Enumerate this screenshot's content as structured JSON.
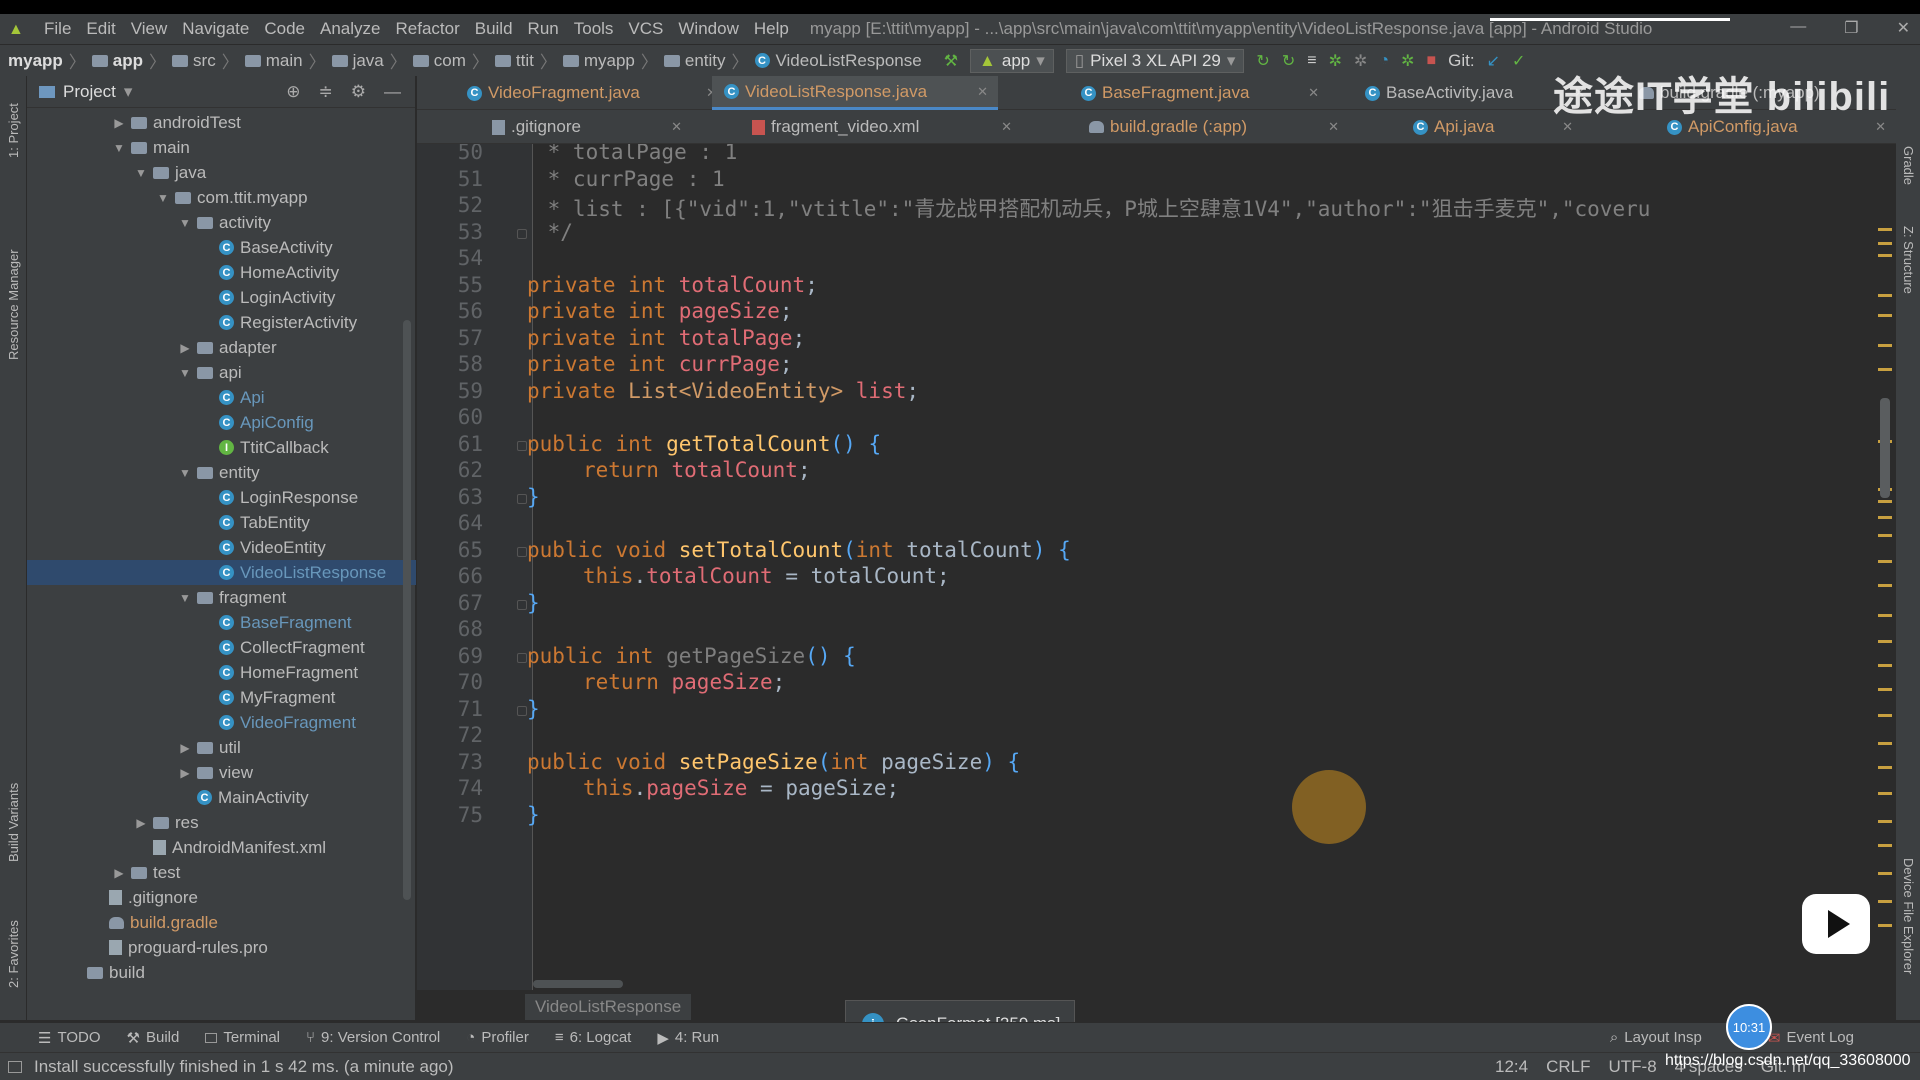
{
  "menu": {
    "items": [
      "File",
      "Edit",
      "View",
      "Navigate",
      "Code",
      "Analyze",
      "Refactor",
      "Build",
      "Run",
      "Tools",
      "VCS",
      "Window",
      "Help"
    ],
    "window_title": "myapp [E:\\ttit\\myapp] - ...\\app\\src\\main\\java\\com\\ttit\\myapp\\entity\\VideoListResponse.java [app] - Android Studio"
  },
  "nav": {
    "crumbs": [
      "myapp",
      "app",
      "src",
      "main",
      "java",
      "com",
      "ttit",
      "myapp",
      "entity",
      "VideoListResponse"
    ],
    "run_config": "app",
    "device": "Pixel 3 XL API 29",
    "git_label": "Git:"
  },
  "project_panel": {
    "title": "Project",
    "tree": [
      {
        "label": "androidTest",
        "depth": 1,
        "type": "folder",
        "arrow": "right"
      },
      {
        "label": "main",
        "depth": 1,
        "type": "folder",
        "arrow": "down"
      },
      {
        "label": "java",
        "depth": 2,
        "type": "folder",
        "arrow": "down"
      },
      {
        "label": "com.ttit.myapp",
        "depth": 3,
        "type": "package",
        "arrow": "down"
      },
      {
        "label": "activity",
        "depth": 4,
        "type": "package",
        "arrow": "down"
      },
      {
        "label": "BaseActivity",
        "depth": 5,
        "type": "class"
      },
      {
        "label": "HomeActivity",
        "depth": 5,
        "type": "class"
      },
      {
        "label": "LoginActivity",
        "depth": 5,
        "type": "class"
      },
      {
        "label": "RegisterActivity",
        "depth": 5,
        "type": "class"
      },
      {
        "label": "adapter",
        "depth": 4,
        "type": "package",
        "arrow": "right"
      },
      {
        "label": "api",
        "depth": 4,
        "type": "package",
        "arrow": "down"
      },
      {
        "label": "Api",
        "depth": 5,
        "type": "class",
        "highlight": true
      },
      {
        "label": "ApiConfig",
        "depth": 5,
        "type": "class",
        "highlight": true
      },
      {
        "label": "TtitCallback",
        "depth": 5,
        "type": "interface"
      },
      {
        "label": "entity",
        "depth": 4,
        "type": "package",
        "arrow": "down"
      },
      {
        "label": "LoginResponse",
        "depth": 5,
        "type": "class"
      },
      {
        "label": "TabEntity",
        "depth": 5,
        "type": "class"
      },
      {
        "label": "VideoEntity",
        "depth": 5,
        "type": "class"
      },
      {
        "label": "VideoListResponse",
        "depth": 5,
        "type": "class",
        "highlight": true,
        "selected": true
      },
      {
        "label": "fragment",
        "depth": 4,
        "type": "package",
        "arrow": "down"
      },
      {
        "label": "BaseFragment",
        "depth": 5,
        "type": "class",
        "highlight": true
      },
      {
        "label": "CollectFragment",
        "depth": 5,
        "type": "class"
      },
      {
        "label": "HomeFragment",
        "depth": 5,
        "type": "class"
      },
      {
        "label": "MyFragment",
        "depth": 5,
        "type": "class"
      },
      {
        "label": "VideoFragment",
        "depth": 5,
        "type": "class",
        "highlight": true
      },
      {
        "label": "util",
        "depth": 4,
        "type": "package",
        "arrow": "right"
      },
      {
        "label": "view",
        "depth": 4,
        "type": "package",
        "arrow": "right"
      },
      {
        "label": "MainActivity",
        "depth": 4,
        "type": "class"
      },
      {
        "label": "res",
        "depth": 2,
        "type": "folder",
        "arrow": "right"
      },
      {
        "label": "AndroidManifest.xml",
        "depth": 2,
        "type": "file"
      },
      {
        "label": "test",
        "depth": 1,
        "type": "folder",
        "arrow": "right"
      },
      {
        "label": ".gitignore",
        "depth": 0,
        "type": "file"
      },
      {
        "label": "build.gradle",
        "depth": 0,
        "type": "gradle",
        "highlight": true
      },
      {
        "label": "proguard-rules.pro",
        "depth": 0,
        "type": "file"
      },
      {
        "label": "build",
        "depth": -1,
        "type": "folder"
      }
    ]
  },
  "tabs_row1": [
    {
      "label": "VideoFragment.java",
      "active": false
    },
    {
      "label": "VideoListResponse.java",
      "active": true
    },
    {
      "label": "BaseFragment.java",
      "active": false
    },
    {
      "label": "BaseActivity.java",
      "active": false
    },
    {
      "label": "build.gradle (:myapp)",
      "active": false
    }
  ],
  "tabs_row2": [
    {
      "label": ".gitignore"
    },
    {
      "label": "fragment_video.xml"
    },
    {
      "label": "build.gradle (:app)"
    },
    {
      "label": "Api.java"
    },
    {
      "label": "ApiConfig.java"
    }
  ],
  "editor": {
    "line_numbers": [
      "50",
      "51",
      "52",
      "53",
      "54",
      "55",
      "56",
      "57",
      "58",
      "59",
      "60",
      "61",
      "62",
      "63",
      "64",
      "65",
      "66",
      "67",
      "68",
      "69",
      "70",
      "71",
      "72",
      "73",
      "74",
      "75"
    ],
    "lines": [
      " * totalPage : 1",
      " * currPage : 1",
      " * list : [{\"vid\":1,\"vtitle\":\"青龙战甲搭配机动兵，P城上空肆意1V4\",\"author\":\"狙击手麦克\",\"coveru",
      " */",
      "",
      "private int totalCount;",
      "private int pageSize;",
      "private int totalPage;",
      "private int currPage;",
      "private List<VideoEntity> list;",
      "",
      "public int getTotalCount() {",
      "    return totalCount;",
      "}",
      "",
      "public void setTotalCount(int totalCount) {",
      "    this.totalCount = totalCount;",
      "}",
      "",
      "public int getPageSize() {",
      "    return pageSize;",
      "}",
      "",
      "public void setPageSize(int pageSize) {",
      "    this.pageSize = pageSize;",
      "}"
    ],
    "structure_breadcrumb": "VideoListResponse"
  },
  "notification": {
    "text": "GsonFormat [259 ms]"
  },
  "bottom_tools": {
    "left": [
      "TODO",
      "Build",
      "Terminal",
      "9: Version Control",
      "Profiler",
      "6: Logcat",
      "4: Run"
    ],
    "right": [
      "Layout Insp",
      "Event Log"
    ]
  },
  "status": {
    "message": "Install successfully finished in 1 s 42 ms. (a minute ago)",
    "position": "12:4",
    "line_sep": "CRLF",
    "encoding": "UTF-8",
    "indent": "4 spaces",
    "git": "Git: m"
  },
  "side_strips": {
    "left": [
      "1: Project",
      "Resource Manager",
      "Build Variants",
      "2: Favorites"
    ],
    "right": [
      "Gradle",
      "Z: Structure",
      "Device File Explorer"
    ]
  },
  "overlays": {
    "watermark": "途途IT学堂 bilibili",
    "blog_url": "https://blog.csdn.net/qq_33608000",
    "clock": "10:31"
  }
}
